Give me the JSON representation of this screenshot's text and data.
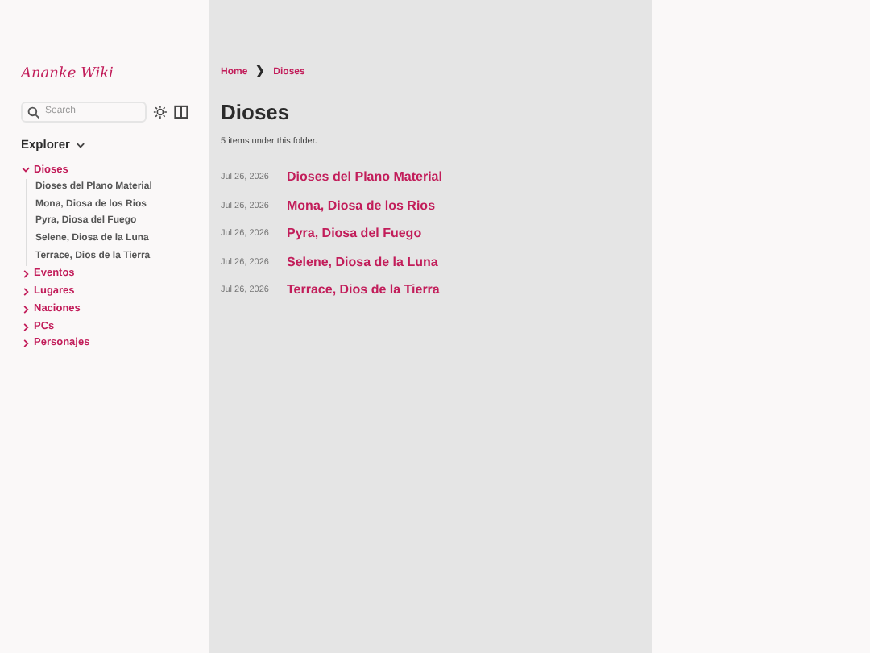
{
  "site_title": "Ananke Wiki",
  "search": {
    "placeholder": "Search"
  },
  "explorer": {
    "label": "Explorer",
    "expanded": true,
    "tree": [
      {
        "label": "Dioses",
        "expanded": true,
        "children": [
          {
            "label": "Dioses del Plano Material"
          },
          {
            "label": "Mona, Diosa de los Rios"
          },
          {
            "label": "Pyra, Diosa del Fuego"
          },
          {
            "label": "Selene, Diosa de la Luna"
          },
          {
            "label": "Terrace, Dios de la Tierra"
          }
        ]
      },
      {
        "label": "Eventos",
        "expanded": false
      },
      {
        "label": "Lugares",
        "expanded": false
      },
      {
        "label": "Naciones",
        "expanded": false
      },
      {
        "label": "PCs",
        "expanded": false
      },
      {
        "label": "Personajes",
        "expanded": false
      }
    ]
  },
  "breadcrumb": [
    {
      "label": "Home"
    },
    {
      "label": "Dioses"
    }
  ],
  "breadcrumb_separator": "❯",
  "page_title": "Dioses",
  "item_count": "5 items under this folder.",
  "items": [
    {
      "date": "Jul 26, 2026",
      "title": "Dioses del Plano Material"
    },
    {
      "date": "Jul 26, 2026",
      "title": "Mona, Diosa de los Rios"
    },
    {
      "date": "Jul 26, 2026",
      "title": "Pyra, Diosa del Fuego"
    },
    {
      "date": "Jul 26, 2026",
      "title": "Selene, Diosa de la Luna"
    },
    {
      "date": "Jul 26, 2026",
      "title": "Terrace, Dios de la Tierra"
    }
  ]
}
